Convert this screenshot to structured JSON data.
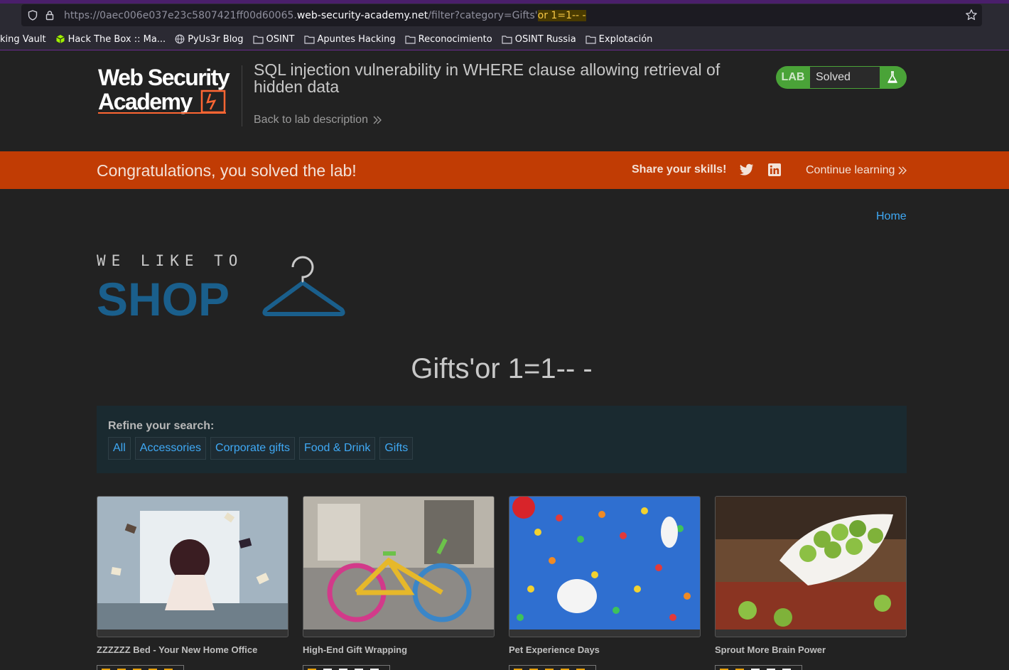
{
  "browser": {
    "url_prefix": "https://0aec006e037e23c5807421ff00d60065.",
    "url_host": "web-security-academy.net",
    "url_path": "/filter?category=Gifts'",
    "url_injection": "or 1=1-- -",
    "bookmarks": [
      {
        "label": "king Vault",
        "icon": "none"
      },
      {
        "label": "Hack The Box :: Ma...",
        "icon": "htb-cube-icon"
      },
      {
        "label": "PyUs3r Blog",
        "icon": "globe-icon"
      },
      {
        "label": "OSINT",
        "icon": "folder-icon"
      },
      {
        "label": "Apuntes Hacking",
        "icon": "folder-icon"
      },
      {
        "label": "Reconocimiento",
        "icon": "folder-icon"
      },
      {
        "label": "OSINT Russia",
        "icon": "folder-icon"
      },
      {
        "label": "Explotación",
        "icon": "folder-icon"
      }
    ]
  },
  "academy": {
    "logo_line1": "Web Security",
    "logo_line2": "Academy",
    "lab_title": "SQL injection vulnerability in WHERE clause allowing retrieval of hidden data",
    "back_link": "Back to lab description",
    "status_prefix": "LAB",
    "status": "Solved",
    "accent_color": "#4aa338"
  },
  "banner": {
    "message": "Congratulations, you solved the lab!",
    "share_label": "Share your skills!",
    "continue_label": "Continue learning",
    "color": "#c13c04"
  },
  "shop": {
    "home_link": "Home",
    "logo_top": "WE LIKE TO",
    "logo_bottom": "SHOP",
    "category_heading": "Gifts'or 1=1-- -",
    "refine_label": "Refine your search:",
    "categories": [
      "All",
      "Accessories",
      "Corporate gifts",
      "Food & Drink",
      "Gifts"
    ],
    "products": [
      {
        "name": "ZZZZZZ Bed - Your New Home Office",
        "stars": 5
      },
      {
        "name": "High-End Gift Wrapping",
        "stars": 1
      },
      {
        "name": "Pet Experience Days",
        "stars": 5
      },
      {
        "name": "Sprout More Brain Power",
        "stars": 2
      }
    ]
  }
}
